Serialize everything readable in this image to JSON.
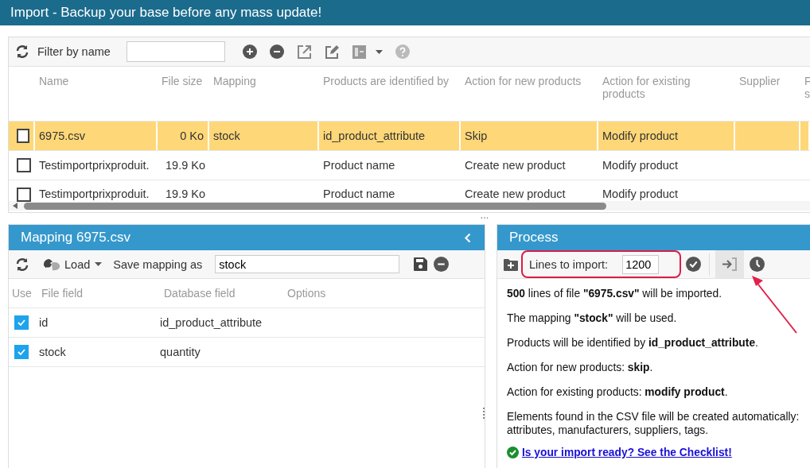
{
  "title": "Import - Backup your base before any mass update!",
  "files": {
    "filter_label": "Filter by name",
    "columns": [
      "Name",
      "File size",
      "Mapping",
      "Products are identified by",
      "Action for new products",
      "Action for existing products",
      "Supplier",
      "F s"
    ],
    "rows": [
      {
        "selected": true,
        "checked": false,
        "cells": [
          "6975.csv",
          "0 Ko",
          "stock",
          "id_product_attribute",
          "Skip",
          "Modify product",
          "",
          ""
        ]
      },
      {
        "selected": false,
        "checked": false,
        "cells": [
          "Testimportprixproduit.",
          "19.9 Ko",
          "",
          "Product name",
          "Create new product",
          "Modify product",
          "",
          ""
        ]
      },
      {
        "selected": false,
        "checked": false,
        "cells": [
          "Testimportprixproduit.",
          "19.9 Ko",
          "",
          "Product name",
          "Create new product",
          "Modify product",
          "",
          ""
        ]
      }
    ]
  },
  "splitter": "...",
  "mapping": {
    "title": "Mapping 6975.csv",
    "load": "Load",
    "save_label": "Save mapping as",
    "save_value": "stock",
    "columns": [
      "Use",
      "File field",
      "Database field",
      "Options"
    ],
    "rows": [
      {
        "checked": true,
        "file_field": "id",
        "database_field": "id_product_attribute"
      },
      {
        "checked": true,
        "file_field": "stock",
        "database_field": "quantity"
      }
    ]
  },
  "process": {
    "title": "Process",
    "lines_label": "Lines to import:",
    "lines_value": "1200",
    "messages": [
      "**500** lines of file **\"6975.csv\"** will be imported.",
      "The mapping **\"stock\"** will be used.",
      "Products will be identified by **id_product_attribute**.",
      "Action for new products: **skip**.",
      "Action for existing products: **modify product**.",
      "Elements found in the CSV file will be created automatically: attributes, manufacturers, suppliers, tags."
    ],
    "checklist_link": "Is your import ready? See the Checklist!"
  }
}
